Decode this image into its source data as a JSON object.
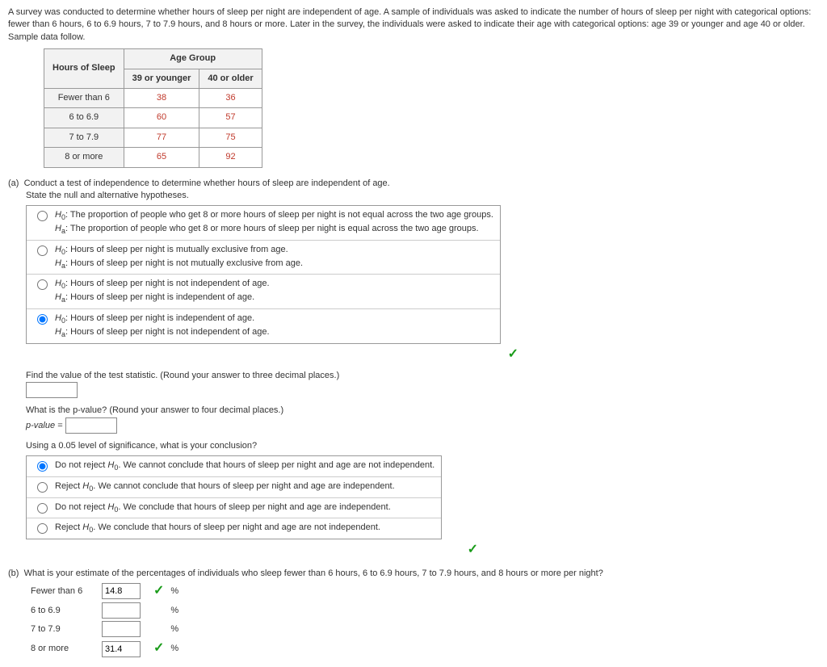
{
  "intro": "A survey was conducted to determine whether hours of sleep per night are independent of age. A sample of individuals was asked to indicate the number of hours of sleep per night with categorical options: fewer than 6 hours, 6 to 6.9 hours, 7 to 7.9 hours, and 8 hours or more. Later in the survey, the individuals were asked to indicate their age with categorical options: age 39 or younger and age 40 or older. Sample data follow.",
  "table": {
    "corner": "Hours of Sleep",
    "group_header": "Age Group",
    "cols": [
      "39 or younger",
      "40 or older"
    ],
    "rows": [
      {
        "label": "Fewer than 6",
        "vals": [
          "38",
          "36"
        ]
      },
      {
        "label": "6 to 6.9",
        "vals": [
          "60",
          "57"
        ]
      },
      {
        "label": "7 to 7.9",
        "vals": [
          "77",
          "75"
        ]
      },
      {
        "label": "8 or more",
        "vals": [
          "65",
          "92"
        ]
      }
    ]
  },
  "part_a": {
    "label": "(a)",
    "prompt": "Conduct a test of independence to determine whether hours of sleep are independent of age.",
    "state_hyp": "State the null and alternative hypotheses.",
    "hyp": [
      {
        "h0": ": The proportion of people who get 8 or more hours of sleep per night is not equal across the two age groups.",
        "ha": ": The proportion of people who get 8 or more hours of sleep per night is equal across the two age groups."
      },
      {
        "h0": ": Hours of sleep per night is mutually exclusive from age.",
        "ha": ": Hours of sleep per night is not mutually exclusive from age."
      },
      {
        "h0": ": Hours of sleep per night is not independent of age.",
        "ha": ": Hours of sleep per night is independent of age."
      },
      {
        "h0": ": Hours of sleep per night is independent of age.",
        "ha": ": Hours of sleep per night is not independent of age."
      }
    ],
    "test_stat_label": "Find the value of the test statistic. (Round your answer to three decimal places.)",
    "pval_label": "What is the p-value? (Round your answer to four decimal places.)",
    "pval_prefix": "p-value = ",
    "conc_label": "Using a 0.05 level of significance, what is your conclusion?",
    "conc": [
      ". We cannot conclude that hours of sleep per night and age are not independent.",
      ". We cannot conclude that hours of sleep per night and age are independent.",
      ". We conclude that hours of sleep per night and age are independent.",
      ". We conclude that hours of sleep per night and age are not independent."
    ],
    "conc_pref": [
      "Do not reject ",
      "Reject ",
      "Do not reject ",
      "Reject "
    ],
    "h0sym": "H",
    "hasym": "H",
    "sub0": "0",
    "suba": "a"
  },
  "part_b": {
    "label": "(b)",
    "prompt": "What is your estimate of the percentages of individuals who sleep fewer than 6 hours, 6 to 6.9 hours, 7 to 7.9 hours, and 8 hours or more per night?",
    "rows": [
      {
        "label": "Fewer than 6",
        "value": "14.8",
        "checked": true
      },
      {
        "label": "6 to 6.9",
        "value": "",
        "checked": false
      },
      {
        "label": "7 to 7.9",
        "value": "",
        "checked": false
      },
      {
        "label": "8 or more",
        "value": "31.4",
        "checked": true
      }
    ],
    "pct": "%"
  }
}
